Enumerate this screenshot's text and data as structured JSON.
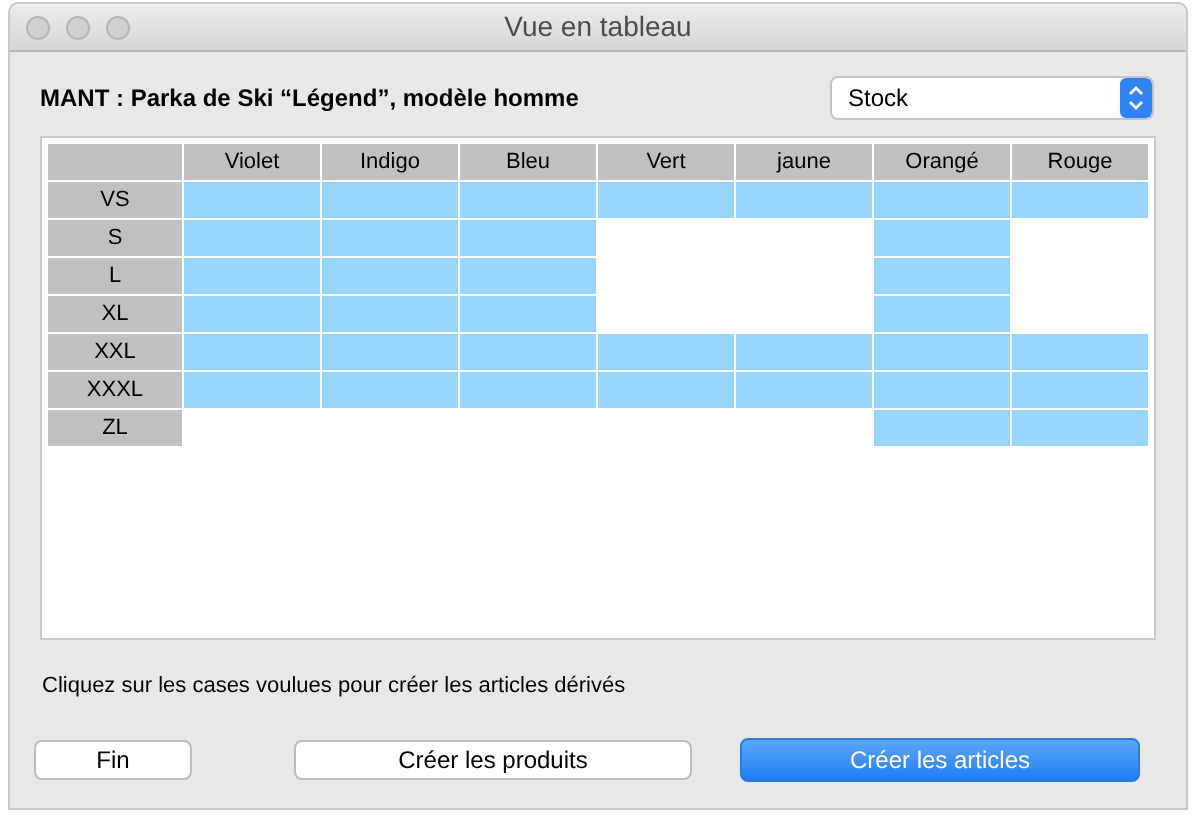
{
  "window": {
    "title": "Vue en tableau"
  },
  "product_title": "MANT : Parka de Ski “Légend”, modèle homme",
  "view_select": {
    "value": "Stock"
  },
  "table": {
    "columns": [
      "Violet",
      "Indigo",
      "Bleu",
      "Vert",
      "jaune",
      "Orangé",
      "Rouge"
    ],
    "rows": [
      {
        "label": "VS",
        "cells": [
          {
            "selected": true
          },
          {
            "selected": true
          },
          {
            "selected": true
          },
          {
            "selected": true
          },
          {
            "selected": true
          },
          {
            "selected": true
          },
          {
            "selected": true
          }
        ]
      },
      {
        "label": "S",
        "cells": [
          {
            "selected": true
          },
          {
            "selected": true
          },
          {
            "selected": true
          },
          {
            "selected": false
          },
          {
            "selected": false
          },
          {
            "selected": true
          },
          {
            "selected": false
          }
        ]
      },
      {
        "label": "L",
        "cells": [
          {
            "selected": true
          },
          {
            "selected": true
          },
          {
            "selected": true
          },
          {
            "selected": false
          },
          {
            "selected": false
          },
          {
            "selected": true
          },
          {
            "selected": false
          }
        ]
      },
      {
        "label": "XL",
        "cells": [
          {
            "selected": true
          },
          {
            "selected": true
          },
          {
            "selected": true
          },
          {
            "selected": false
          },
          {
            "selected": false
          },
          {
            "selected": true
          },
          {
            "selected": false
          }
        ]
      },
      {
        "label": "XXL",
        "cells": [
          {
            "selected": true
          },
          {
            "selected": true
          },
          {
            "selected": true
          },
          {
            "selected": true
          },
          {
            "selected": true
          },
          {
            "selected": true
          },
          {
            "selected": true
          }
        ]
      },
      {
        "label": "XXXL",
        "cells": [
          {
            "selected": true
          },
          {
            "selected": true
          },
          {
            "selected": true
          },
          {
            "selected": true
          },
          {
            "selected": true
          },
          {
            "selected": true
          },
          {
            "selected": true
          }
        ]
      },
      {
        "label": "ZL",
        "cells": [
          {
            "selected": false
          },
          {
            "selected": false
          },
          {
            "selected": false
          },
          {
            "selected": false
          },
          {
            "selected": false
          },
          {
            "selected": true
          },
          {
            "selected": true
          }
        ]
      }
    ]
  },
  "hint": "Cliquez sur les cases voulues pour créer les articles dérivés",
  "buttons": [
    {
      "label": "Fin",
      "kind": "plain"
    },
    {
      "label": "Créer les produits",
      "kind": "plain"
    },
    {
      "label": "Créer les articles",
      "kind": "default"
    }
  ]
}
